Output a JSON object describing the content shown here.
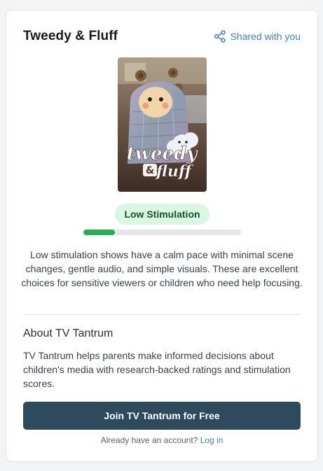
{
  "show": {
    "title": "Tweedy & Fluff",
    "poster_alt": "Tweedy & Fluff poster"
  },
  "share": {
    "label": "Shared with you",
    "icon": "share-icon"
  },
  "stimulation": {
    "level_label": "Low Stimulation",
    "level_fraction": 0.2,
    "description": "Low stimulation shows have a calm pace with minimal scene changes, gentle audio, and simple visuals. These are excellent choices for sensitive viewers or children who need help focusing."
  },
  "about": {
    "heading": "About TV Tantrum",
    "text": "TV Tantrum helps parents make informed decisions about children's media with research-backed ratings and stimulation scores."
  },
  "cta": {
    "join_label": "Join TV Tantrum for Free",
    "login_prompt": "Already have an account?",
    "login_link": "Log in"
  },
  "colors": {
    "accent": "#3b82c4",
    "badge_bg": "#d9f7e3",
    "meter_fill": "#22b252",
    "button_bg": "#2d4b5c"
  }
}
